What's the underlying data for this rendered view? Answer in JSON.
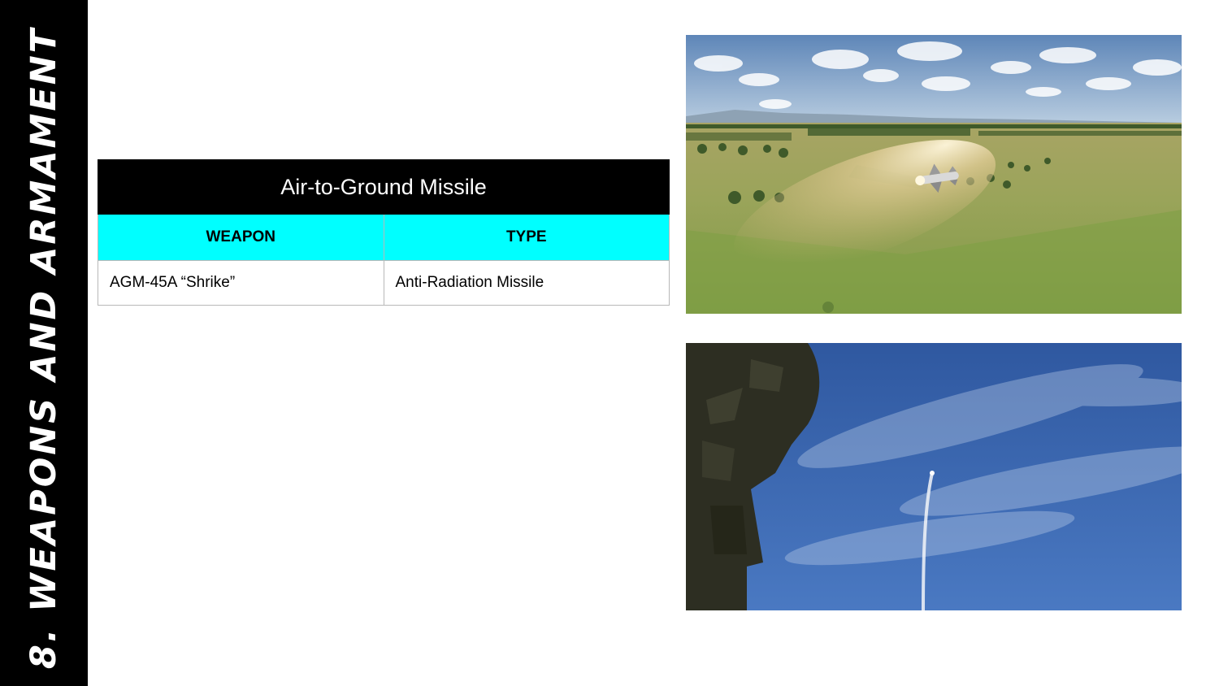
{
  "sidebar": {
    "title": "8. Weapons and Armament"
  },
  "table": {
    "title": "Air-to-Ground Missile",
    "headers": [
      "WEAPON",
      "TYPE"
    ],
    "rows": [
      {
        "weapon": "AGM-45A “Shrike”",
        "type": "Anti-Radiation Missile"
      }
    ]
  },
  "colors": {
    "sidebar_bg": "#000000",
    "table_title_bg": "#000000",
    "table_header_bg": "#00ffff"
  }
}
